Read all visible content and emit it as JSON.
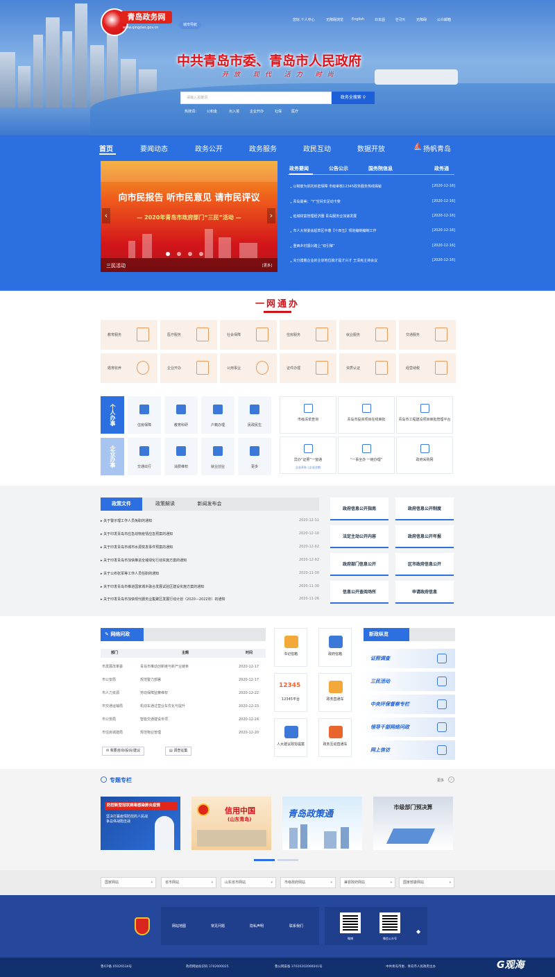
{
  "header": {
    "logo_text": "青岛政务网",
    "logo_url": "www.qingdao.gov.cn",
    "guide_btn": "城市导航",
    "top_links": [
      "您好,个人中心",
      "无障碍浏览",
      "English",
      "日本語",
      "한국어",
      "无障碍",
      "公众邮箱"
    ],
    "gov_title": "中共青岛市委、青岛市人民政府",
    "slogan": "开放 现代 活力 时尚",
    "search_placeholder": "请输入关键词",
    "search_btn": "政务全搜索",
    "hotwords": [
      "热搜词：",
      "公积金",
      "出入境",
      "企业开办",
      "社保",
      "医疗"
    ]
  },
  "nav": {
    "items": [
      "首页",
      "要闻动态",
      "政务公开",
      "政务服务",
      "政民互动",
      "数据开放",
      "扬帆青岛"
    ]
  },
  "slider": {
    "headline": "向市民报告 听市民意见 请市民评议",
    "sub": "— 2020年青岛市政府部门“三民”活动 —",
    "caption": "三民活动",
    "more": "[更多]"
  },
  "news": {
    "tabs": [
      "政务要闻",
      "公告公示",
      "国务院信息",
      "政务通"
    ],
    "rows": [
      {
        "title": "以制度为依托织密保障 市级审核12345政务服务热线揭秘",
        "date": "[2020-12-16]"
      },
      {
        "title": "青岛最美：“Y”空间长足动卡斐",
        "date": "[2020-12-16]"
      },
      {
        "title": "延城财富管理经济圈 青岛服务业加速发展",
        "date": "[2020-12-16]"
      },
      {
        "title": "市人大常委会起草区中着【十四五】规划编制编制工作",
        "date": "[2020-12-16]"
      },
      {
        "title": "重西乡村振兴踏上“双引擎”",
        "date": "[2020-12-16]"
      },
      {
        "title": "充分摸着企业的主体地位搞才提才兴才 王清宪主持会议",
        "date": "[2020-12-16]"
      }
    ]
  },
  "ywtb": {
    "title": "一网通办",
    "services": [
      "教育服务",
      "医疗服务",
      "社会保障",
      "住房服务",
      "就业服务",
      "交通服务",
      "婚育收养",
      "企业开办",
      "公用事业",
      "证件办理",
      "资质认证",
      "经营纳税"
    ]
  },
  "personal": {
    "tab_personal": "个人办事",
    "tab_enterprise": "企业办事",
    "items": [
      "住房保障",
      "教育科研",
      "户籍办理",
      "民政民生",
      "交通出行",
      "消费维权",
      "就业创业",
      "更多"
    ],
    "right": [
      {
        "label": "市级清单查询"
      },
      {
        "label": "青岛市投资项目在线审批"
      },
      {
        "label": "青岛市工程建设项目审批管理平台"
      },
      {
        "label": "异办“证照”一窗通",
        "sub": "企业开办 | 企业注销"
      },
      {
        "label": "“一事全办 一链办理”"
      },
      {
        "label": "政府采购网"
      }
    ]
  },
  "policy": {
    "tabs": [
      "政策文件",
      "政策解读",
      "新闻发布会"
    ],
    "rows": [
      {
        "title": "关于警示理工作人员免职的通知",
        "date": "2020-12-11"
      },
      {
        "title": "关于印发青岛市应急动物疫情应急预案的通知",
        "date": "2020-12-10"
      },
      {
        "title": "关于印发青岛市城市水源突发事件预案的通知",
        "date": "2020-12-02"
      },
      {
        "title": "关于印发青岛市加快推进全域绿化行动实施方案的通知",
        "date": "2020-12-02"
      },
      {
        "title": "关于公布张军等工作人员任职的通知",
        "date": "2020-11-30"
      },
      {
        "title": "关于印发青岛市推进国家城乡融合发展试验区建设实施方案的通知",
        "date": "2020-11-30"
      },
      {
        "title": "关于印发青岛市加快现代服务业集聚区发展行动计划（2020—2022年）的通知",
        "date": "2020-11-26"
      }
    ],
    "buttons": [
      "政府信息公开指南",
      "政府信息公开制度",
      "法定主动公开内容",
      "政府信息公开年报",
      "政府部门信息公开",
      "区市政府信息公开",
      "信息公开查阅场所",
      "申请政府信息"
    ]
  },
  "interaction": {
    "head": "网络问政",
    "cols": [
      "部门",
      "主题",
      "时间"
    ],
    "rows": [
      {
        "dept": "市发展改革委",
        "topic": "青岛市推动创新链与新产业链条",
        "date": "2020-12-17"
      },
      {
        "dept": "市公安局",
        "topic": "规范警力部署",
        "date": "2020-12-17"
      },
      {
        "dept": "市人力资源",
        "topic": "劳动保障监察维权",
        "date": "2020-12-22"
      },
      {
        "dept": "市交通运输局",
        "topic": "机动车通过营业车优化与提升",
        "date": "2020-12-23"
      },
      {
        "dept": "市公安局",
        "topic": "智能交通建设专项",
        "date": "2020-12-24"
      },
      {
        "dept": "市住房城建局",
        "topic": "规范物业管理",
        "date": "2020-12-20"
      }
    ],
    "buttons": [
      "我要咨询/投诉/建议",
      "调查征集"
    ],
    "mid": [
      "书记信箱",
      "政府信箱",
      "12345平台",
      "政务直通车",
      "人大建议政协提案",
      "政务互动直通车"
    ],
    "right_head": "新政纵览",
    "right": [
      "证照调查",
      "三民活动",
      "中央环保督察专栏",
      "领导干部网络问政",
      "网上信访"
    ]
  },
  "special": {
    "title": "专题专栏",
    "more": "更多",
    "cards": [
      {
        "line1": "防控新型冠状病毒感染肺炎疫情",
        "line2": "坚决打赢疫情防控的人民战争总体战阻击战"
      },
      {
        "line1": "信用中国",
        "line2": "(山东青岛)"
      },
      {
        "line1": "青岛政策通"
      },
      {
        "line1": "市级部门预决算"
      }
    ]
  },
  "links": {
    "selects": [
      "国家网站",
      "省市网站",
      "山东省市网站",
      "市级政府网站",
      "兼容政府网站",
      "国家部委网站"
    ]
  },
  "footer": {
    "links": [
      "网站地图",
      "常见问题",
      "隐私声明",
      "联系我们"
    ],
    "qr": [
      "微博",
      "微信公众号"
    ],
    "bottom": [
      "鲁ICP备 05026534号",
      "政府网站标识码 3702000025",
      "鲁公网安备 37020202000041号",
      "中共青岛市委、青岛市人民政府主办"
    ],
    "brand": "G观海"
  }
}
